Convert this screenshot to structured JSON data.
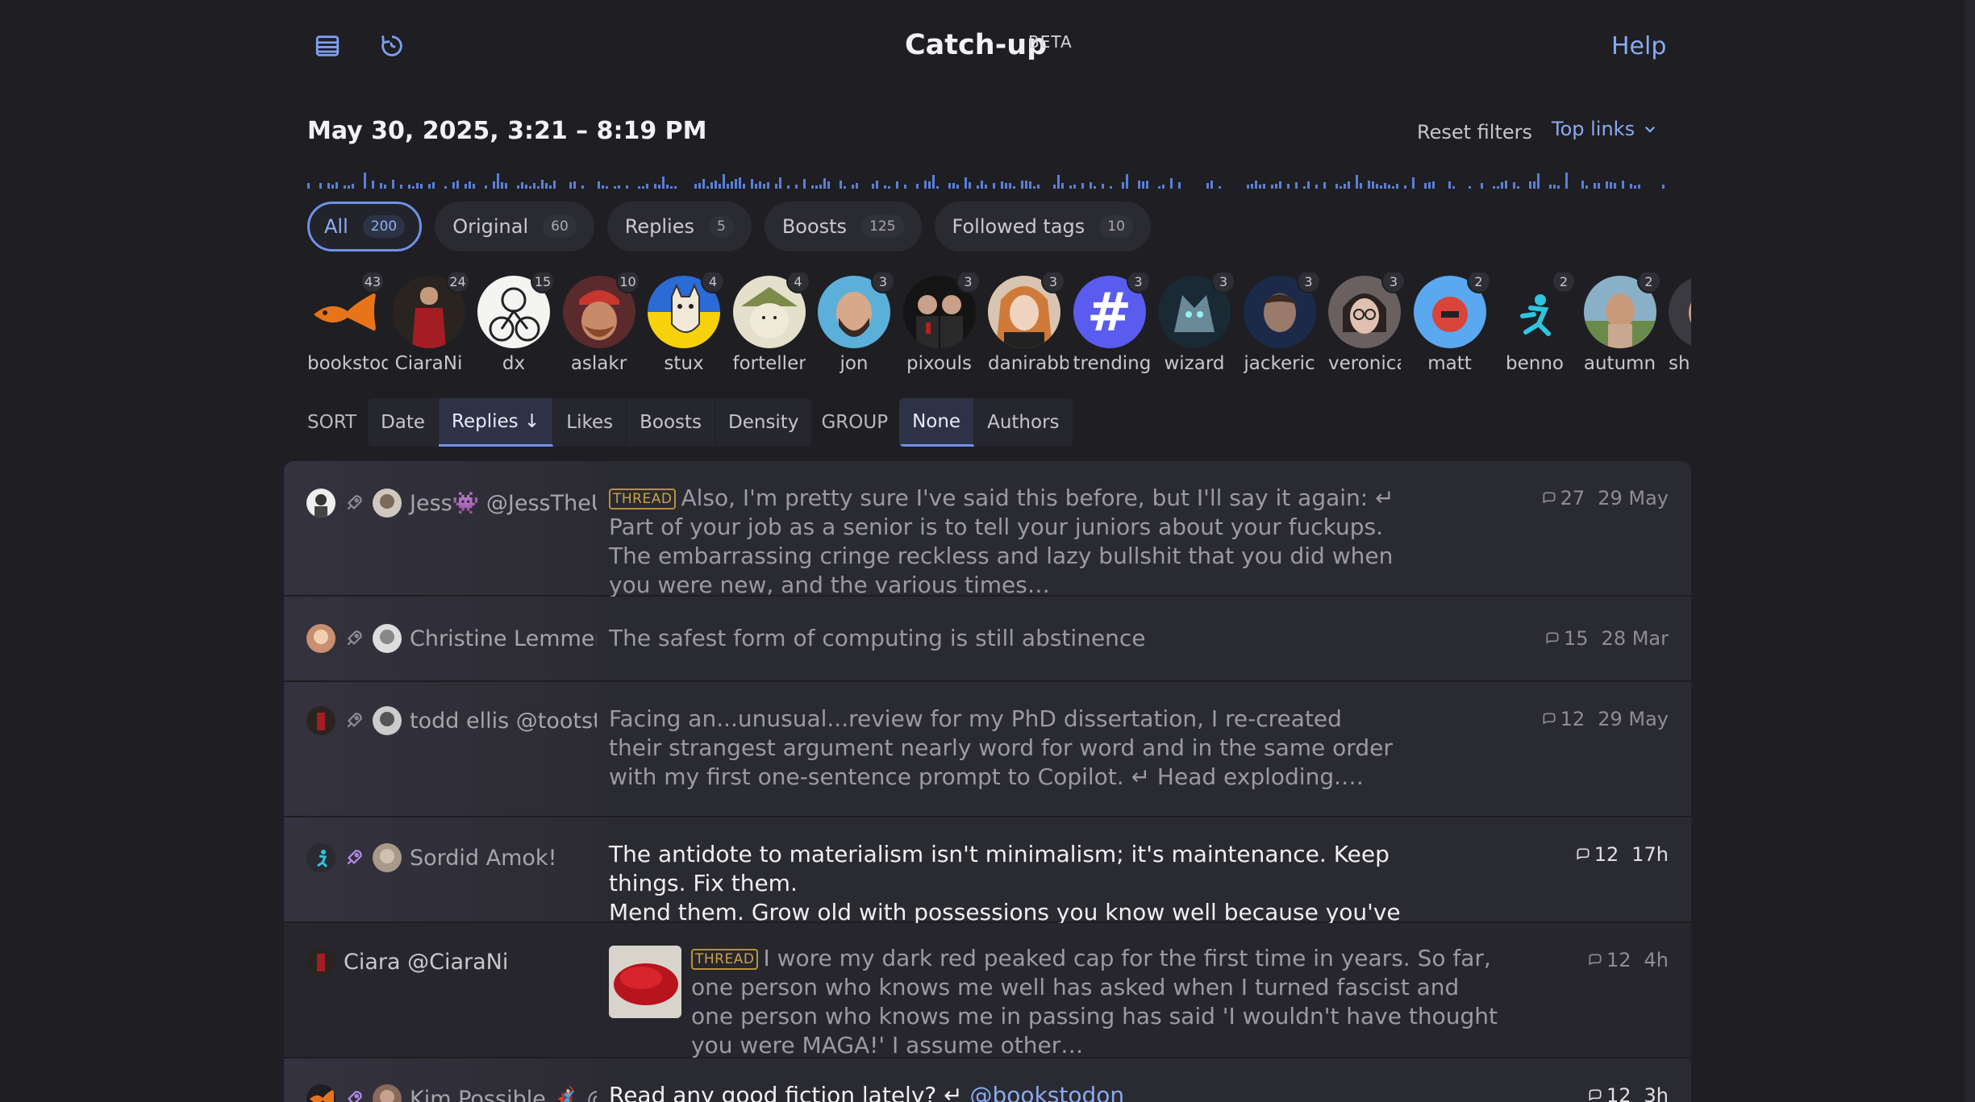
{
  "header": {
    "title": "Catch-up",
    "badge": "BETA",
    "help": "Help",
    "icons": [
      "list-icon",
      "refresh-icon"
    ]
  },
  "range": {
    "label": "May 30, 2025, 3:21 – 8:19 PM",
    "reset_filters": "Reset filters",
    "top_links": "Top links"
  },
  "filters": [
    {
      "label": "All",
      "count": "200",
      "active": true
    },
    {
      "label": "Original",
      "count": "60"
    },
    {
      "label": "Replies",
      "count": "5"
    },
    {
      "label": "Boosts",
      "count": "125"
    },
    {
      "label": "Followed tags",
      "count": "10"
    }
  ],
  "accounts": [
    {
      "name": "bookstodon",
      "count": "43"
    },
    {
      "name": "CiaraNi",
      "count": "24"
    },
    {
      "name": "dx",
      "count": "15"
    },
    {
      "name": "aslakr",
      "count": "10"
    },
    {
      "name": "stux",
      "count": "4"
    },
    {
      "name": "forteller",
      "count": "4"
    },
    {
      "name": "jon",
      "count": "3"
    },
    {
      "name": "pixouls",
      "count": "3"
    },
    {
      "name": "danirabbit",
      "count": "3"
    },
    {
      "name": "trending",
      "count": "3"
    },
    {
      "name": "wizard",
      "count": "3"
    },
    {
      "name": "jackeric",
      "count": "3"
    },
    {
      "name": "veronica",
      "count": "3"
    },
    {
      "name": "matt",
      "count": "2"
    },
    {
      "name": "benno",
      "count": "2"
    },
    {
      "name": "autumn",
      "count": "2"
    },
    {
      "name": "sh",
      "count": ""
    }
  ],
  "sort": {
    "label": "SORT",
    "options": [
      "Date",
      "Replies ↓",
      "Likes",
      "Boosts",
      "Density"
    ],
    "group_label": "GROUP",
    "group_options": [
      "None",
      "Authors"
    ]
  },
  "posts": [
    {
      "author": "Jess👾 @JessTheUnstill",
      "thread": "THREAD",
      "text": "Also, I'm pretty sure I've said this before, but I'll say it again: ↵ Part of your job as a senior is to tell your juniors about your fuckups. The embarrassing cringe reckless and lazy bullshit that you did when you were new, and the various times…",
      "replies": "27",
      "date": "29 May"
    },
    {
      "author": "Christine Lemmer-Webber",
      "text": "The safest form of computing is still abstinence",
      "replies": "15",
      "date": "28 Mar"
    },
    {
      "author": "todd ellis @tootstodd",
      "text_lines": [
        "Facing an...unusual...review for my PhD dissertation, I re-created",
        "their strangest argument nearly word for word and in the same order",
        "with my first one-sentence prompt to Copilot. ↵ Head exploding.…"
      ],
      "replies": "12",
      "date": "29 May"
    },
    {
      "author": "Sordid Amok!",
      "text_lines": [
        "The antidote to materialism isn't minimalism; it's maintenance. Keep things. Fix them.",
        "Mend them. Grow old with possessions you know well because you've cared for them."
      ],
      "replies": "12",
      "date": "17h"
    },
    {
      "author": "Ciara @CiaraNi",
      "thread": "THREAD",
      "text": "I wore my dark red peaked cap for the first time in years. So far, one person who knows me well has asked when I turned fascist and one person who knows me in passing has said 'I wouldn't have thought you were MAGA!' I assume other…",
      "replies": "12",
      "date": "4h"
    },
    {
      "author": "Kim Possible 🦸🏻‍♀️ @…",
      "text_prefix": "Read any good fiction lately? ↵",
      "mention": "@bookstodon",
      "replies": "12",
      "date": "3h"
    }
  ],
  "colors": {
    "background": "#1e1e23",
    "accent": "#6f91e8",
    "thread_tag": "#c9a24d",
    "trending": "#5a5cf0"
  }
}
